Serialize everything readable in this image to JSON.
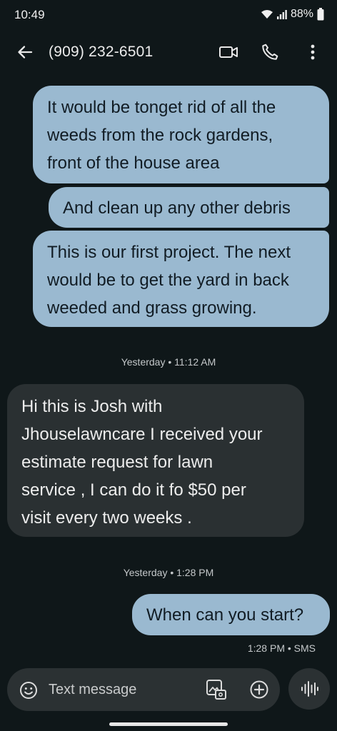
{
  "status_bar": {
    "time": "10:49",
    "battery": "88%",
    "icons": [
      "wifi-icon",
      "signal-icon",
      "battery-icon"
    ]
  },
  "app_bar": {
    "title": "(909) 232-6501",
    "icons": [
      "back-arrow-icon",
      "video-call-icon",
      "phone-icon",
      "more-vert-icon"
    ]
  },
  "messages": [
    {
      "direction": "outgoing",
      "lines": [
        "It would be tonget rid of all the",
        "weeds from the rock gardens,",
        "front of the house area"
      ]
    },
    {
      "direction": "outgoing",
      "lines": [
        "And clean up any other debris"
      ]
    },
    {
      "direction": "outgoing",
      "lines": [
        "This is our first project. The next",
        "would be to get the yard in back",
        "weeded and grass growing."
      ]
    },
    {
      "direction": "incoming",
      "lines": [
        "Hi this is Josh with",
        "Jhouselawncare I received your",
        "estimate request for lawn",
        "service , I can do it fo $50 per",
        "visit every two weeks ."
      ]
    },
    {
      "direction": "outgoing",
      "lines": [
        "When can you start?"
      ]
    }
  ],
  "timestamps": [
    "Yesterday • 11:12 AM",
    "Yesterday • 1:28 PM"
  ],
  "last_message_meta": "1:28 PM • SMS",
  "composer": {
    "placeholder": "Text message",
    "icons": [
      "emoji-icon",
      "gallery-icon",
      "add-circle-icon",
      "voice-input-icon"
    ]
  },
  "colors": {
    "background": "#0f1719",
    "outgoing_bubble": "#9ab9d0",
    "incoming_bubble": "#2a3032",
    "composer": "#2b3133"
  }
}
